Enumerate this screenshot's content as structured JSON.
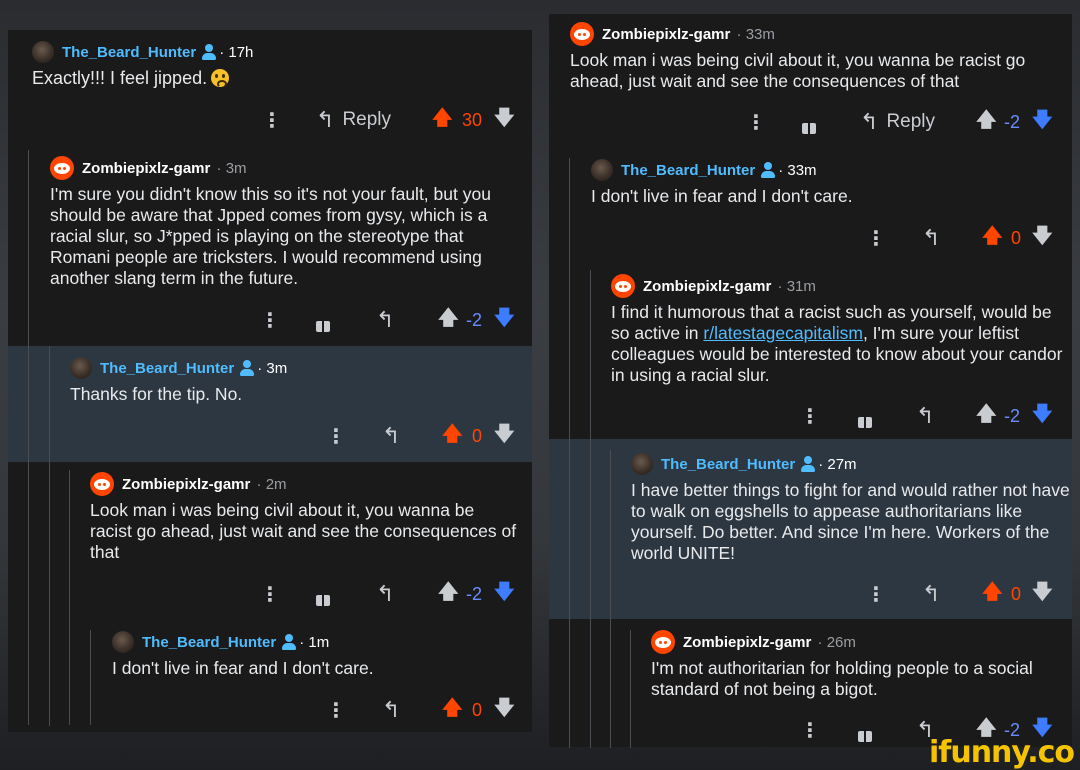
{
  "left": {
    "c1": {
      "user": "The_Beard_Hunter",
      "age": "17h",
      "body": "Exactly!!! I feel jipped.",
      "reply": "Reply",
      "score": "30"
    },
    "c2": {
      "user": "Zombiepixlz-gamr",
      "age": "3m",
      "body": "I'm sure you didn't know this so it's not your fault, but you should be aware that Jpped comes from gysy, which is a racial slur, so J*pped is playing on the stereotype that Romani people are tricksters. I would recommend using another slang term in the future.",
      "score": "-2"
    },
    "c3": {
      "user": "The_Beard_Hunter",
      "age": "3m",
      "body": "Thanks for the tip. No.",
      "score": "0"
    },
    "c4": {
      "user": "Zombiepixlz-gamr",
      "age": "2m",
      "body": "Look man i was being civil about it, you wanna be racist go ahead, just wait and see the consequences of that",
      "score": "-2"
    },
    "c5": {
      "user": "The_Beard_Hunter",
      "age": "1m",
      "body": "I don't live in fear and I don't care.",
      "score": "0"
    }
  },
  "right": {
    "c1": {
      "user": "Zombiepixlz-gamr",
      "age": "33m",
      "body": "Look man i was being civil about it, you wanna be racist go ahead, just wait and see the consequences of that",
      "reply": "Reply",
      "score": "-2"
    },
    "c2": {
      "user": "The_Beard_Hunter",
      "age": "33m",
      "body": "I don't live in fear and I don't care.",
      "score": "0"
    },
    "c3": {
      "user": "Zombiepixlz-gamr",
      "age": "31m",
      "body_pre": "I find it humorous that a racist such as yourself, would be so active in ",
      "link": "r/latestagecapitalism",
      "body_post": ", I'm sure your leftist colleagues would be interested to know about your candor in using a racial slur.",
      "score": "-2"
    },
    "c4": {
      "user": "The_Beard_Hunter",
      "age": "27m",
      "body": "I have better things to fight for and would rather not have to walk on eggshells to appease authoritarians like yourself. Do better. And since I'm here. Workers of the world UNITE!",
      "score": "0"
    },
    "c5": {
      "user": "Zombiepixlz-gamr",
      "age": "26m",
      "body": "I'm not authoritarian for holding people to a social standard of not being a bigot.",
      "score": "-2"
    }
  },
  "watermark": "ifunny.co",
  "icons": {
    "more": "more-vert-icon",
    "award": "gift-icon",
    "reply": "reply-arrow-icon",
    "upvote": "upvote-arrow-icon",
    "downvote": "downvote-arrow-icon",
    "user": "user-profile-icon"
  },
  "colors": {
    "bg": "#1a1a1b",
    "highlight": "#2d3742",
    "upvote": "#ff4500",
    "downvote": "#3d7bff",
    "username": "#4fbcff",
    "watermark": "#f5c400"
  }
}
